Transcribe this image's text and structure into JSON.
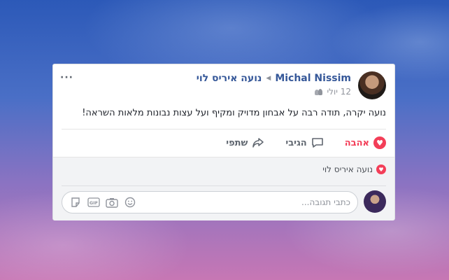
{
  "post": {
    "author": "Michal Nissim",
    "recipient": "נועה איריס לוי",
    "date": "12 יולי",
    "privacy_icon": "friends-icon",
    "more_label": "···",
    "text": "נועה יקרה, תודה רבה על אבחון מדויק ומקיף ועל עצות נבונות מלאות השראה!"
  },
  "actions": {
    "love_label": "אהבה",
    "comment_label": "הגיבי",
    "share_label": "שתפי"
  },
  "reactions": {
    "name": "נועה איריס לוי"
  },
  "comment_box": {
    "placeholder": "כתבי תגובה..."
  },
  "colors": {
    "accent": "#365899",
    "love": "#f33e58",
    "muted": "#90949c"
  }
}
